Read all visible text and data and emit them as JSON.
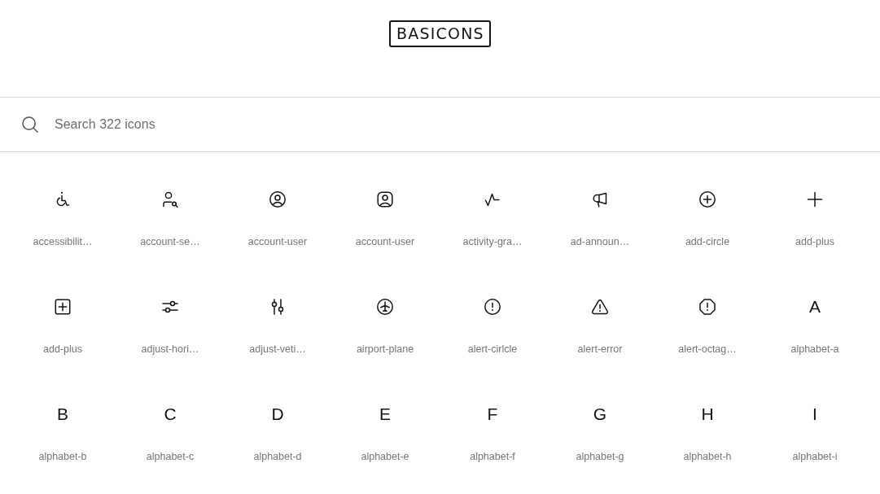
{
  "logo": "BASICONS",
  "search": {
    "placeholder": "Search 322 icons"
  },
  "icons": [
    {
      "label": "accessibilit…",
      "kind": "drawing"
    },
    {
      "label": "account-se…",
      "kind": "drawing"
    },
    {
      "label": "account-user",
      "kind": "drawing"
    },
    {
      "label": "account-user",
      "kind": "drawing"
    },
    {
      "label": "activity-gra…",
      "kind": "drawing"
    },
    {
      "label": "ad-announ…",
      "kind": "drawing"
    },
    {
      "label": "add-circle",
      "kind": "drawing"
    },
    {
      "label": "add-plus",
      "kind": "drawing"
    },
    {
      "label": "add-plus",
      "kind": "drawing"
    },
    {
      "label": "adjust-hori…",
      "kind": "drawing"
    },
    {
      "label": "adjust-veti…",
      "kind": "drawing"
    },
    {
      "label": "airport-plane",
      "kind": "drawing"
    },
    {
      "label": "alert-cirlcle",
      "kind": "drawing"
    },
    {
      "label": "alert-error",
      "kind": "drawing"
    },
    {
      "label": "alert-octag…",
      "kind": "drawing"
    },
    {
      "label": "alphabet-a",
      "kind": "letter",
      "glyph": "A"
    },
    {
      "label": "alphabet-b",
      "kind": "letter",
      "glyph": "B"
    },
    {
      "label": "alphabet-c",
      "kind": "letter",
      "glyph": "C"
    },
    {
      "label": "alphabet-d",
      "kind": "letter",
      "glyph": "D"
    },
    {
      "label": "alphabet-e",
      "kind": "letter",
      "glyph": "E"
    },
    {
      "label": "alphabet-f",
      "kind": "letter",
      "glyph": "F"
    },
    {
      "label": "alphabet-g",
      "kind": "letter",
      "glyph": "G"
    },
    {
      "label": "alphabet-h",
      "kind": "letter",
      "glyph": "H"
    },
    {
      "label": "alphabet-i",
      "kind": "letter",
      "glyph": "I"
    }
  ]
}
